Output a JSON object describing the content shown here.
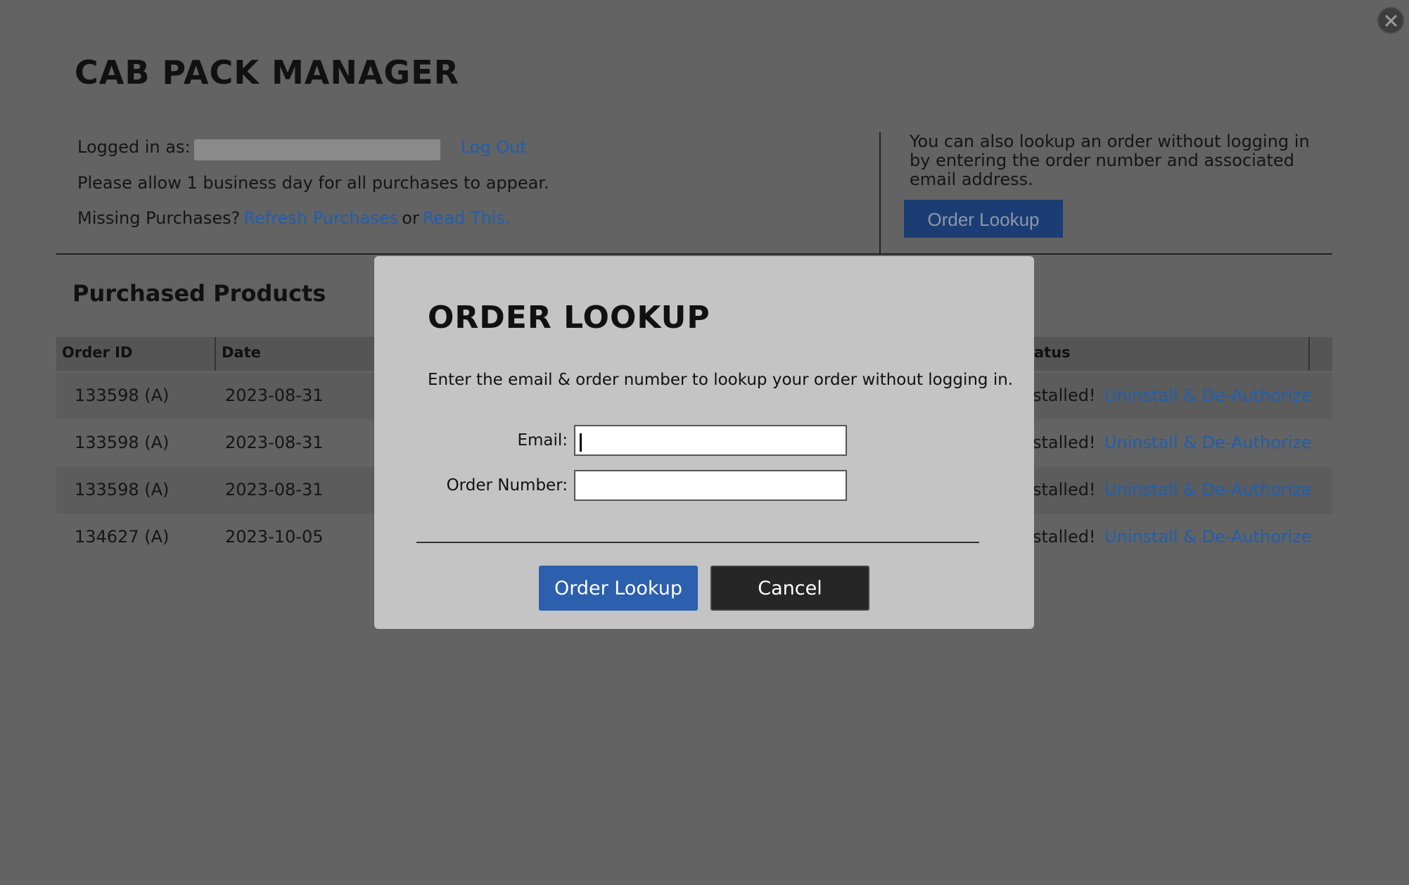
{
  "app": {
    "title": "CAB PACK MANAGER"
  },
  "account": {
    "logged_in_label": "Logged in as:",
    "logout_label": "Log Out",
    "notice": "Please allow 1 business day for all purchases to appear.",
    "missing_label": "Missing Purchases?",
    "refresh_label": "Refresh Purchases",
    "or_label": "or",
    "read_label": "Read This."
  },
  "side": {
    "text": "You can also lookup an order without logging in by entering the order number and associated email address.",
    "button_label": "Order Lookup"
  },
  "products": {
    "title": "Purchased Products",
    "columns": [
      "Order ID",
      "Date",
      "atus"
    ],
    "rows": [
      {
        "order_id": "133598 (A)",
        "date": "2023-08-31",
        "status": "stalled!",
        "action": "Uninstall & De-Authorize"
      },
      {
        "order_id": "133598 (A)",
        "date": "2023-08-31",
        "status": "stalled!",
        "action": "Uninstall & De-Authorize"
      },
      {
        "order_id": "133598 (A)",
        "date": "2023-08-31",
        "status": "stalled!",
        "action": "Uninstall & De-Authorize"
      },
      {
        "order_id": "134627 (A)",
        "date": "2023-10-05",
        "status": "stalled!",
        "action": "Uninstall & De-Authorize"
      }
    ]
  },
  "modal": {
    "title": "ORDER LOOKUP",
    "description": "Enter the email & order number to lookup your order without logging in.",
    "email_label": "Email:",
    "email_value": "",
    "order_label": "Order Number:",
    "order_value": "",
    "submit_label": "Order Lookup",
    "cancel_label": "Cancel"
  },
  "colors": {
    "overlay": "#636363",
    "modal_bg": "#c4c4c4",
    "primary": "#2c5fad",
    "link": "#1f5fae",
    "dark_button": "#262626"
  },
  "icons": {
    "close": "close-icon"
  }
}
